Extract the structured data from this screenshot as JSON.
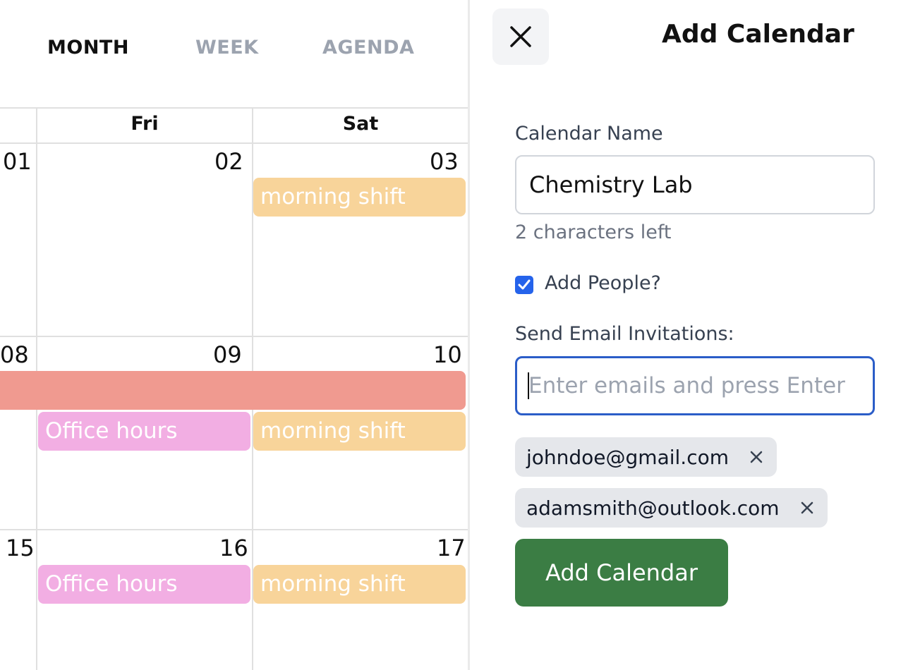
{
  "view_tabs": {
    "month": "MONTH",
    "week": "WEEK",
    "agenda": "AGENDA",
    "active": "month"
  },
  "calendar": {
    "weekdays": [
      "Fri",
      "Sat"
    ],
    "weeks": [
      {
        "dates": [
          "01",
          "02",
          "03"
        ]
      },
      {
        "dates": [
          "08",
          "09",
          "10"
        ]
      },
      {
        "dates": [
          "15",
          "16",
          "17"
        ]
      }
    ],
    "events": {
      "morning_shift": "morning shift",
      "office_hours": "Office hours"
    },
    "colors": {
      "morning_shift": "#f8d49a",
      "office_hours": "#f2aee3",
      "multi_day": "#f09a90"
    }
  },
  "panel": {
    "title": "Add Calendar",
    "close_icon": "close-icon",
    "name_label": "Calendar Name",
    "name_value": "Chemistry Lab",
    "chars_left": "2 characters left",
    "add_people_label": "Add People?",
    "add_people_checked": true,
    "invite_label": "Send Email Invitations:",
    "email_placeholder": "Enter emails and press Enter",
    "email_value": "",
    "emails": [
      "johndoe@gmail.com",
      "adamsmith@outlook.com"
    ],
    "submit_label": "Add Calendar",
    "submit_color": "#3b7d44",
    "focus_color": "#2b5dc8"
  }
}
